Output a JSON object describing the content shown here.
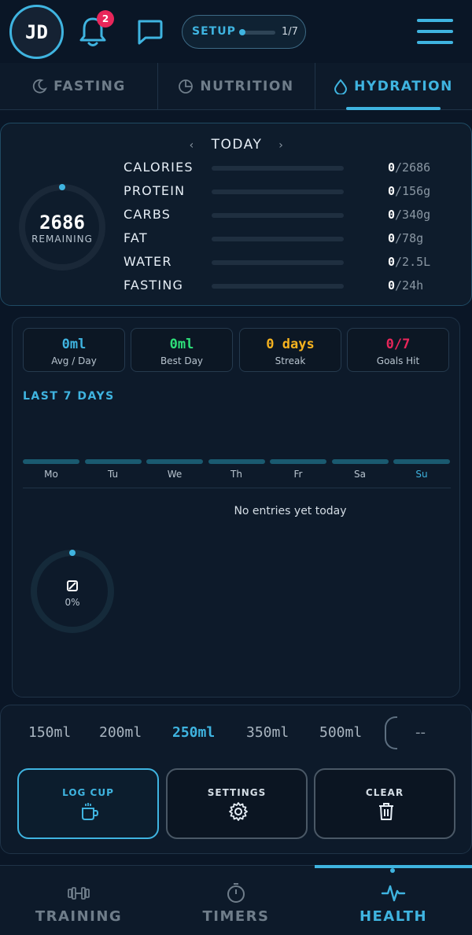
{
  "header": {
    "avatar_initials": "JD",
    "notification_count": "2",
    "setup": {
      "label": "SETUP",
      "progress": "1/7",
      "progress_fraction": 0.14
    }
  },
  "tabs": [
    {
      "label": "FASTING",
      "icon": "moon-icon",
      "active": false
    },
    {
      "label": "NUTRITION",
      "icon": "pie-icon",
      "active": false
    },
    {
      "label": "HYDRATION",
      "icon": "droplet-icon",
      "active": true
    }
  ],
  "summary": {
    "day_label": "TODAY",
    "prev": "‹",
    "next": "›",
    "remaining_value": "2686",
    "remaining_label": "REMAINING",
    "macros": [
      {
        "label": "CALORIES",
        "current": "0",
        "target": "/2686",
        "fraction": 0
      },
      {
        "label": "PROTEIN",
        "current": "0",
        "target": "/156g",
        "fraction": 0
      },
      {
        "label": "CARBS",
        "current": "0",
        "target": "/340g",
        "fraction": 0
      },
      {
        "label": "FAT",
        "current": "0",
        "target": "/78g",
        "fraction": 0
      },
      {
        "label": "WATER",
        "current": "0",
        "target": "/2.5L",
        "fraction": 0
      },
      {
        "label": "FASTING",
        "current": "0",
        "target": "/24h",
        "fraction": 0
      }
    ]
  },
  "hydration_stats": {
    "cards": [
      {
        "value": "0ml",
        "label": "Avg / Day",
        "color": "#3fb4e0"
      },
      {
        "value": "0ml",
        "label": "Best Day",
        "color": "#2ee07a"
      },
      {
        "value": "0 days",
        "label": "Streak",
        "color": "#f5b21f"
      },
      {
        "value": "0/7",
        "label": "Goals Hit",
        "color": "#e8265a"
      }
    ],
    "section_title": "LAST 7 DAYS",
    "days": [
      "Mo",
      "Tu",
      "We",
      "Th",
      "Fr",
      "Sa",
      "Su"
    ],
    "current_day_index": 6,
    "empty_message": "No entries yet today",
    "progress_value": "0",
    "progress_percent": "0%"
  },
  "cups": {
    "sizes": [
      "150ml",
      "200ml",
      "250ml",
      "350ml",
      "500ml"
    ],
    "selected_index": 2,
    "custom_value": "--",
    "actions": [
      {
        "label": "LOG CUP",
        "icon": "cup-icon"
      },
      {
        "label": "SETTINGS",
        "icon": "gear-icon"
      },
      {
        "label": "CLEAR",
        "icon": "trash-icon"
      }
    ]
  },
  "bottom_nav": [
    {
      "label": "TRAINING",
      "icon": "dumbbell-icon",
      "active": false
    },
    {
      "label": "TIMERS",
      "icon": "stopwatch-icon",
      "active": false
    },
    {
      "label": "HEALTH",
      "icon": "pulse-icon",
      "active": true
    }
  ],
  "colors": {
    "accent": "#3fb4e0",
    "background": "#0a1626",
    "badge": "#e8265a"
  }
}
